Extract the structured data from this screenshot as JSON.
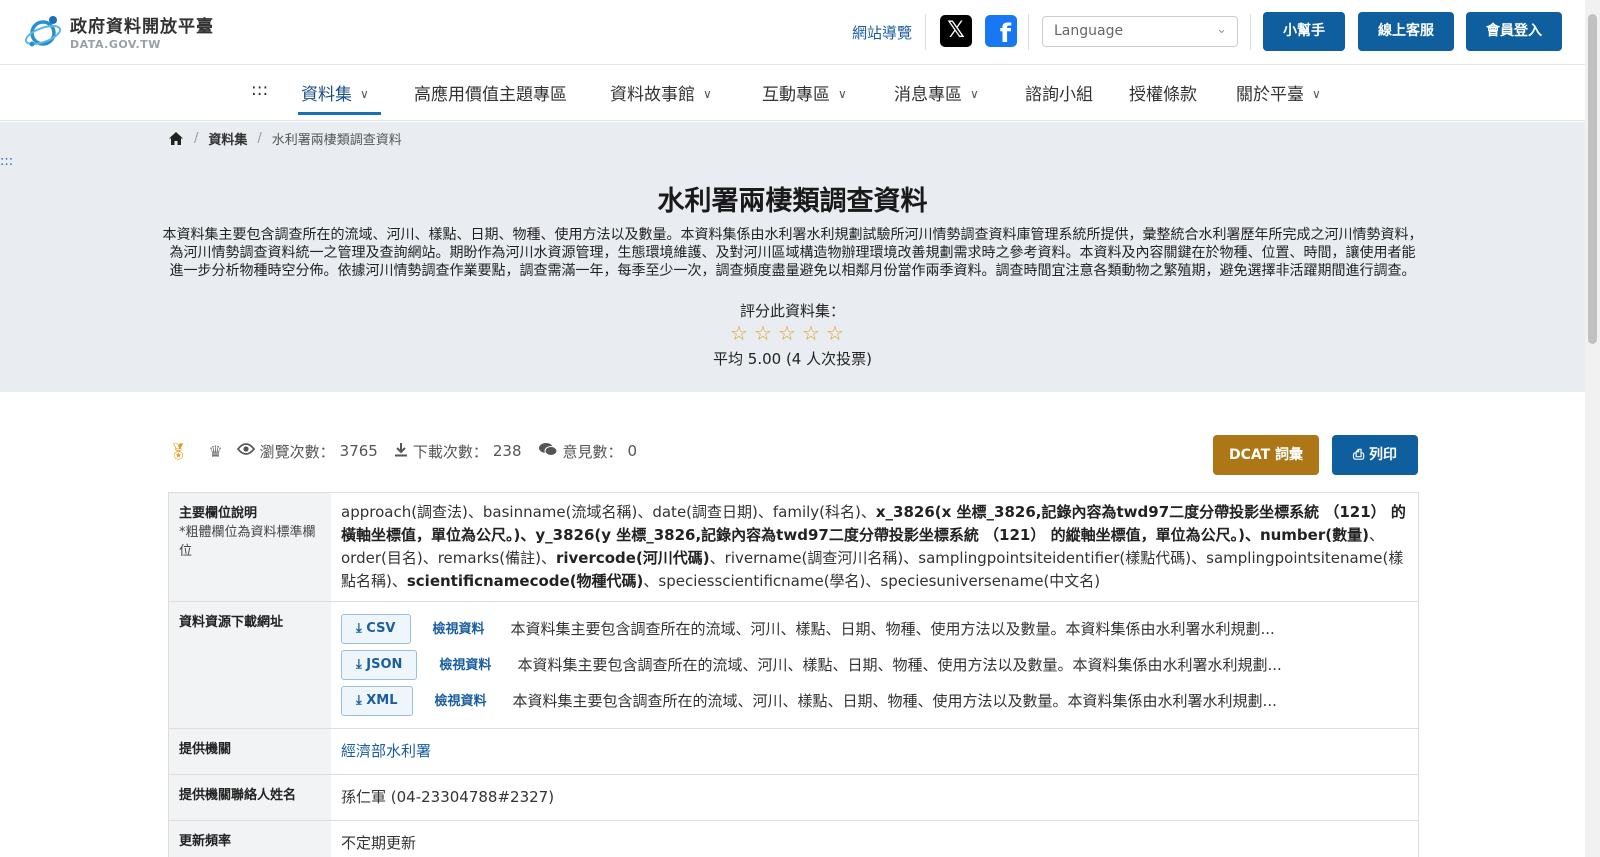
{
  "header": {
    "logo_title": "政府資料開放平臺",
    "logo_sub": "DATA.GOV.TW",
    "site_nav": "網站導覽",
    "language_placeholder": "Language",
    "btn_helper": "小幫手",
    "btn_support": "線上客服",
    "btn_login": "會員登入"
  },
  "nav": {
    "menu_icon": ":::",
    "items": [
      "資料集",
      "高應用價值主題專區",
      "資料故事館",
      "互動專區",
      "消息專區",
      "諮詢小組",
      "授權條款",
      "關於平臺"
    ]
  },
  "breadcrumb": {
    "dataset": "資料集",
    "current": "水利署兩棲類調查資料"
  },
  "skip_link": ":::",
  "dataset": {
    "title": "水利署兩棲類調查資料",
    "description_lines": [
      "本資料集主要包含調查所在的流域、河川、樣點、日期、物種、使用方法以及數量。本資料集係由水利署水利規劃試驗所河川情勢調查資料庫管理系統所提供，彙整統合水利署歷年所完成之河川情勢資料，",
      "為河川情勢調查資料統一之管理及查詢網站。期盼作為河川水資源管理，生態環境維護、及對河川區域構造物辦理環境改善規劃需求時之參考資料。本資料及內容關鍵在於物種、位置、時間，讓使用者能",
      "進一步分析物種時空分佈。依據河川情勢調查作業要點，調查需滿一年，每季至少一次，調查頻度盡量避免以相鄰月份當作兩季資料。調查時間宜注意各類動物之繁殖期，避免選擇非活躍期間進行調查。"
    ],
    "rate_label": "評分此資料集：",
    "rating_average": "平均 5.00 (4 人次投票)"
  },
  "stats": {
    "views_label": "瀏覽次數：",
    "views": "3765",
    "downloads_label": "下載次數：",
    "downloads": "238",
    "comments_label": "意見數：",
    "comments": "0",
    "dcat_btn": "DCAT 詞彙",
    "print_btn": "列印"
  },
  "table": {
    "fields_label": "主要欄位說明",
    "fields_note": "*粗體欄位為資料標準欄位",
    "fields_parts": {
      "p1": "approach(調查法)、basinname(流域名稱)、date(調查日期)、family(科名)、",
      "b1": "x_3826(x 坐標_3826,記錄內容為twd97二度分帶投影坐標系統 （121） 的橫軸坐標值，單位為公尺。)、y_3826(y 坐標_3826,記錄內容為twd97二度分帶投影坐標系統 （121） 的縱軸坐標值，單位為公尺。)、number(數量)",
      "p2": "、order(目名)、remarks(備註)、",
      "b2": "rivercode(河川代碼)",
      "p3": "、rivername(調查河川名稱)、samplingpointsiteidentifier(樣點代碼)、samplingpointsitename(樣點名稱)、",
      "b3": "scientificnamecode(物種代碼)",
      "p4": "、speciesscientificname(學名)、speciesuniversename(中文名)"
    },
    "download_label": "資料資源下載網址",
    "downloads": [
      {
        "format": "CSV",
        "view": "檢視資料",
        "desc": "本資料集主要包含調查所在的流域、河川、樣點、日期、物種、使用方法以及數量。本資料集係由水利署水利規劃..."
      },
      {
        "format": "JSON",
        "view": "檢視資料",
        "desc": "本資料集主要包含調查所在的流域、河川、樣點、日期、物種、使用方法以及數量。本資料集係由水利署水利規劃..."
      },
      {
        "format": "XML",
        "view": "檢視資料",
        "desc": "本資料集主要包含調查所在的流域、河川、樣點、日期、物種、使用方法以及數量。本資料集係由水利署水利規劃..."
      }
    ],
    "provider_label": "提供機關",
    "provider": "經濟部水利署",
    "contact_label": "提供機關聯絡人姓名",
    "contact": "孫仁軍 (04-23304788#2327)",
    "update_label": "更新頻率",
    "update": "不定期更新"
  }
}
